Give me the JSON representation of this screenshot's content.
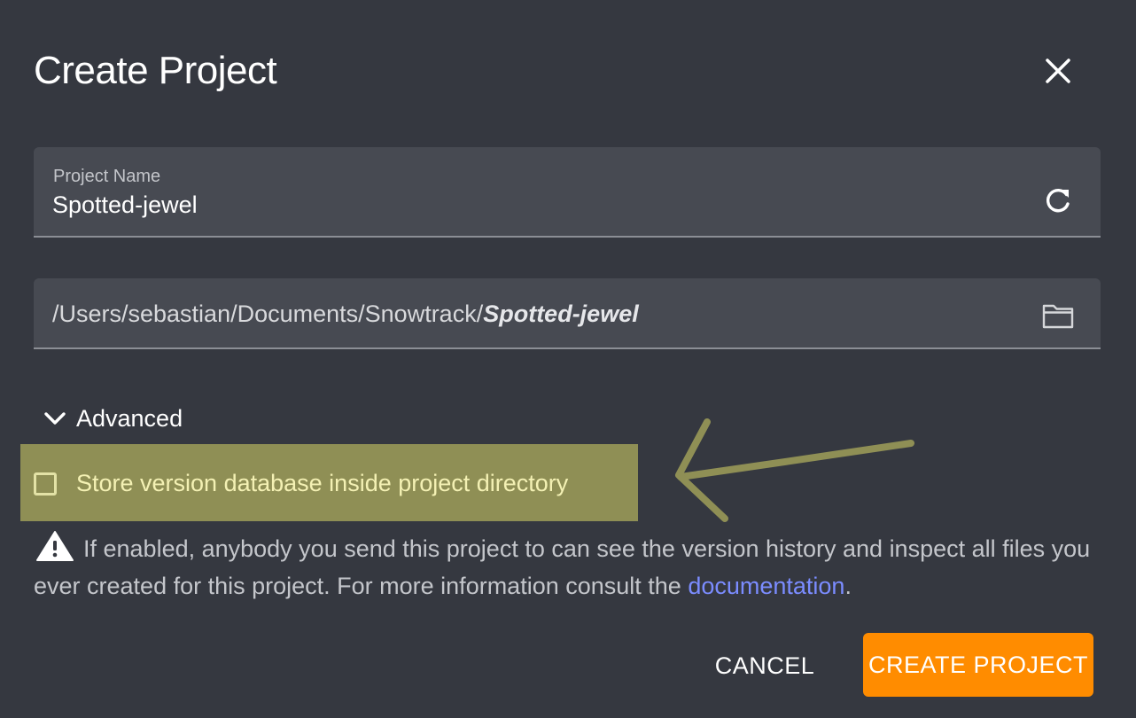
{
  "dialog": {
    "title": "Create Project"
  },
  "project_name": {
    "label": "Project Name",
    "value": "Spotted-jewel",
    "icon": "refresh-icon"
  },
  "project_path": {
    "prefix": "/Users/sebastian/Documents/Snowtrack/",
    "name": "Spotted-jewel",
    "icon": "folder-icon"
  },
  "advanced": {
    "label": "Advanced",
    "expanded": true,
    "store_db_option": {
      "label": "Store version database inside project directory",
      "checked": false
    },
    "warning": {
      "text": "If enabled, anybody you send this project to can see the version history and inspect all files you ever created for this project. For more information consult the ",
      "link_text": "documentation",
      "suffix": "."
    }
  },
  "buttons": {
    "cancel": "CANCEL",
    "create": "CREATE PROJECT"
  },
  "colors": {
    "background": "#353840",
    "field": "#474a52",
    "accent": "#ff8c00",
    "link": "#7b8cff",
    "highlight": "#8f8f55"
  }
}
